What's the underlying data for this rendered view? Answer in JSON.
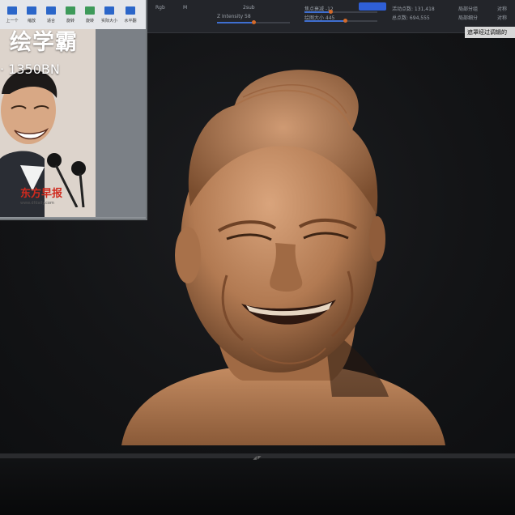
{
  "app": {
    "shelf": {
      "rgb_label": "Rgb",
      "m_label": "M",
      "active_button": "",
      "two_sub_label": "2sub",
      "draw_size_label": "Z Intensity 58",
      "focal_shift_label": "焦点衰减 -12",
      "draw_size2_label": "绘图大小 445",
      "active_points": "活动点数: 131,418",
      "total_points": "总点数: 694,555",
      "right_label_1": "局部分组",
      "right_label_2": "局部细分",
      "right_label_3": "对称",
      "right_label_4": "对称",
      "slider_values": [
        0.5,
        0.35,
        0.55
      ]
    },
    "tooltip": "遮罩经过调辑的"
  },
  "photo_window": {
    "toolbar_buttons": [
      {
        "label": "上一个",
        "icon": "arrow-icon"
      },
      {
        "label": "缩放",
        "icon": "zoom-icon"
      },
      {
        "label": "适合",
        "icon": "fit-icon"
      },
      {
        "label": "旋转",
        "icon": "rotate-icon"
      },
      {
        "label": "旋转",
        "icon": "rotate-icon"
      },
      {
        "label": "实际大小",
        "icon": "size-icon"
      },
      {
        "label": "水平翻",
        "icon": "flip-icon"
      }
    ],
    "title": "绘学霸",
    "count_text": "· 1350BN",
    "paper_logo": "东方早报",
    "paper_url": "www.dfdaily.com"
  },
  "monitor": {
    "brand_mark": "◢◤"
  }
}
